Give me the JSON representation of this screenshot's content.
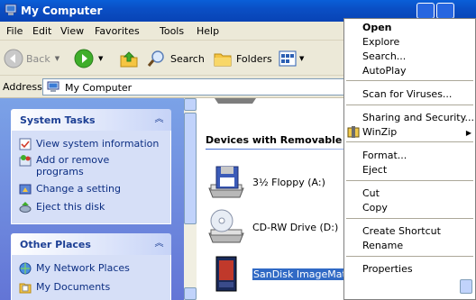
{
  "window": {
    "title": "My Computer"
  },
  "menubar": {
    "items": [
      "File",
      "Edit",
      "View",
      "Favorites",
      "Tools",
      "Help"
    ]
  },
  "toolbar": {
    "back_label": "Back",
    "search_label": "Search",
    "folders_label": "Folders"
  },
  "address": {
    "label": "Address",
    "value": "My Computer"
  },
  "system_tasks": {
    "title": "System Tasks",
    "items": [
      "View system information",
      "Add or remove programs",
      "Change a setting",
      "Eject this disk"
    ]
  },
  "other_places": {
    "title": "Other Places",
    "items": [
      "My Network Places",
      "My Documents"
    ]
  },
  "main": {
    "group_title": "Devices with Removable Sto",
    "drives": [
      {
        "label": "3½ Floppy (A:)",
        "icon": "floppy-drive-icon"
      },
      {
        "label": "CD-RW Drive (D:)",
        "icon": "cd-drive-icon"
      },
      {
        "label": "SanDisk ImageMate (E:)",
        "icon": "removable-drive-icon"
      }
    ]
  },
  "context_menu": {
    "items": [
      {
        "label": "Open",
        "bold": true
      },
      {
        "label": "Explore"
      },
      {
        "label": "Search..."
      },
      {
        "label": "AutoPlay"
      },
      {
        "label": "Scan for Viruses..."
      },
      {
        "label": "Sharing and Security..."
      },
      {
        "label": "WinZip",
        "submenu": true
      },
      {
        "label": "Format..."
      },
      {
        "label": "Eject"
      },
      {
        "label": "Cut"
      },
      {
        "label": "Copy"
      },
      {
        "label": "Create Shortcut"
      },
      {
        "label": "Rename"
      },
      {
        "label": "Properties"
      }
    ]
  },
  "colors": {
    "titlebar": "#0a4fc5",
    "task_pane": "#7ba2e7",
    "selection": "#316ac5"
  }
}
